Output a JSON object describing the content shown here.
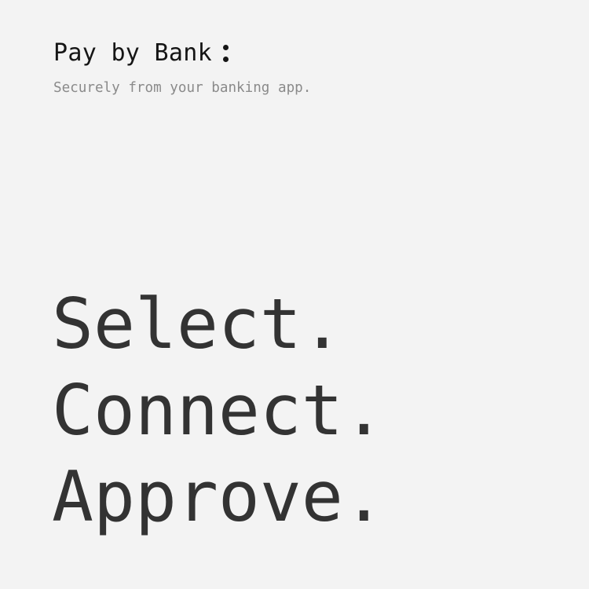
{
  "brand": {
    "name": "Pay by Bank",
    "icon": "two-dots-icon"
  },
  "subtitle": "Securely from your banking app.",
  "headline": {
    "line1": "Select.",
    "line2": "Connect.",
    "line3": "Approve."
  },
  "colors": {
    "background": "#f3f3f3",
    "brand_text": "#151515",
    "subtitle_text": "#8a8a8a",
    "headline_text": "#333333"
  }
}
